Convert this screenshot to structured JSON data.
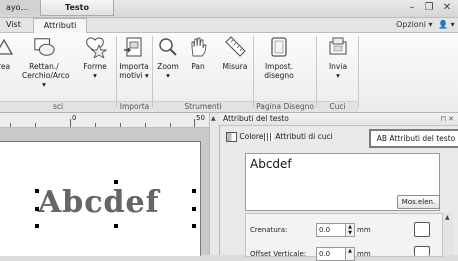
{
  "titlebar": {
    "layout_tab": "ayo...",
    "context_tab": "Testo",
    "minimize": "–",
    "restore": "❐",
    "close": "✕"
  },
  "ribbon_tabs": [
    {
      "label": "Vist",
      "active": false
    },
    {
      "label": "Attributi",
      "active": true
    }
  ],
  "options": {
    "label": "Opzioni",
    "help": "▾"
  },
  "ribbon": {
    "buttons": [
      {
        "label_line1": "rea",
        "label_line2": ""
      },
      {
        "label_line1": "Rettan./",
        "label_line2": "Cerchio/Arco ▾"
      },
      {
        "label_line1": "Forme",
        "label_line2": "▾"
      },
      {
        "label_line1": "Importa",
        "label_line2": "motivi ▾"
      },
      {
        "label_line1": "Zoom",
        "label_line2": "▾"
      },
      {
        "label_line1": "Pan",
        "label_line2": ""
      },
      {
        "label_line1": "Misura",
        "label_line2": ""
      },
      {
        "label_line1": "Impost.",
        "label_line2": "disegno"
      },
      {
        "label_line1": "Invia",
        "label_line2": "▾"
      }
    ],
    "groups": [
      "sci",
      "Importa",
      "Strumenti",
      "Pagina Disegno",
      "Cuci"
    ]
  },
  "ruler": {
    "labels": [
      "0",
      "50"
    ]
  },
  "canvas": {
    "embroidery_text": "Abcdef"
  },
  "panel": {
    "title": "Attributi del testo",
    "pin": "⊓ ✕",
    "tabs": [
      {
        "label": "Colore",
        "icon": "color-icon"
      },
      {
        "label": "Attributi di cuci",
        "icon": "stitch-icon"
      },
      {
        "label": "AB Attributi del testo",
        "icon": "text-attr-icon",
        "active": true
      }
    ],
    "text_value": "Abcdef",
    "mos_button": "Mos.elen.",
    "properties": [
      {
        "label": "Crenatura:",
        "value": "0.0",
        "unit": "mm"
      },
      {
        "label": "Offset Verticale:",
        "value": "0.0",
        "unit": "mm"
      }
    ]
  }
}
